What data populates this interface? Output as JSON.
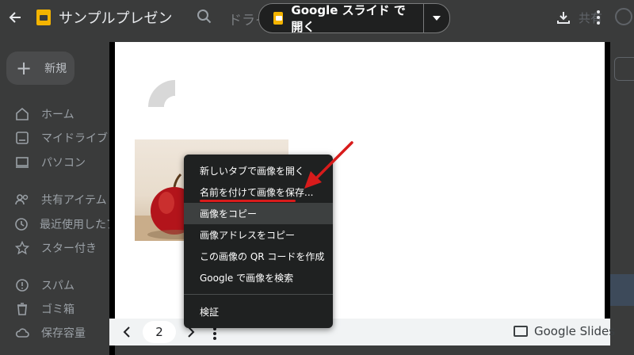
{
  "topbar": {
    "title": "サンプルプレゼン",
    "search_hint": "ドライ",
    "open_button_label": "Google スライド で開く",
    "partial_label": "共有"
  },
  "sidebar": {
    "new_label": "新規",
    "items": [
      {
        "label": "ホーム",
        "icon": "home-icon"
      },
      {
        "label": "マイドライブ",
        "icon": "my-drive-icon"
      },
      {
        "label": "パソコン",
        "icon": "computer-icon"
      },
      {
        "label": "共有アイテム",
        "icon": "shared-icon"
      },
      {
        "label": "最近使用したア",
        "icon": "recent-icon"
      },
      {
        "label": "スター付き",
        "icon": "star-icon"
      },
      {
        "label": "スパム",
        "icon": "spam-icon"
      },
      {
        "label": "ゴミ箱",
        "icon": "trash-icon"
      },
      {
        "label": "保存容量",
        "icon": "cloud-icon"
      }
    ]
  },
  "viewer": {
    "page_number": "2",
    "brand_label": "Google Slides"
  },
  "context_menu": {
    "items": [
      "新しいタブで画像を開く",
      "名前を付けて画像を保存...",
      "画像をコピー",
      "画像アドレスをコピー",
      "この画像の QR コードを作成",
      "Google で画像を検索"
    ],
    "inspect_label": "検証",
    "highlighted_index": 2
  },
  "colors": {
    "annotation": "#d81b1b",
    "slides_brand": "#f4b400"
  }
}
